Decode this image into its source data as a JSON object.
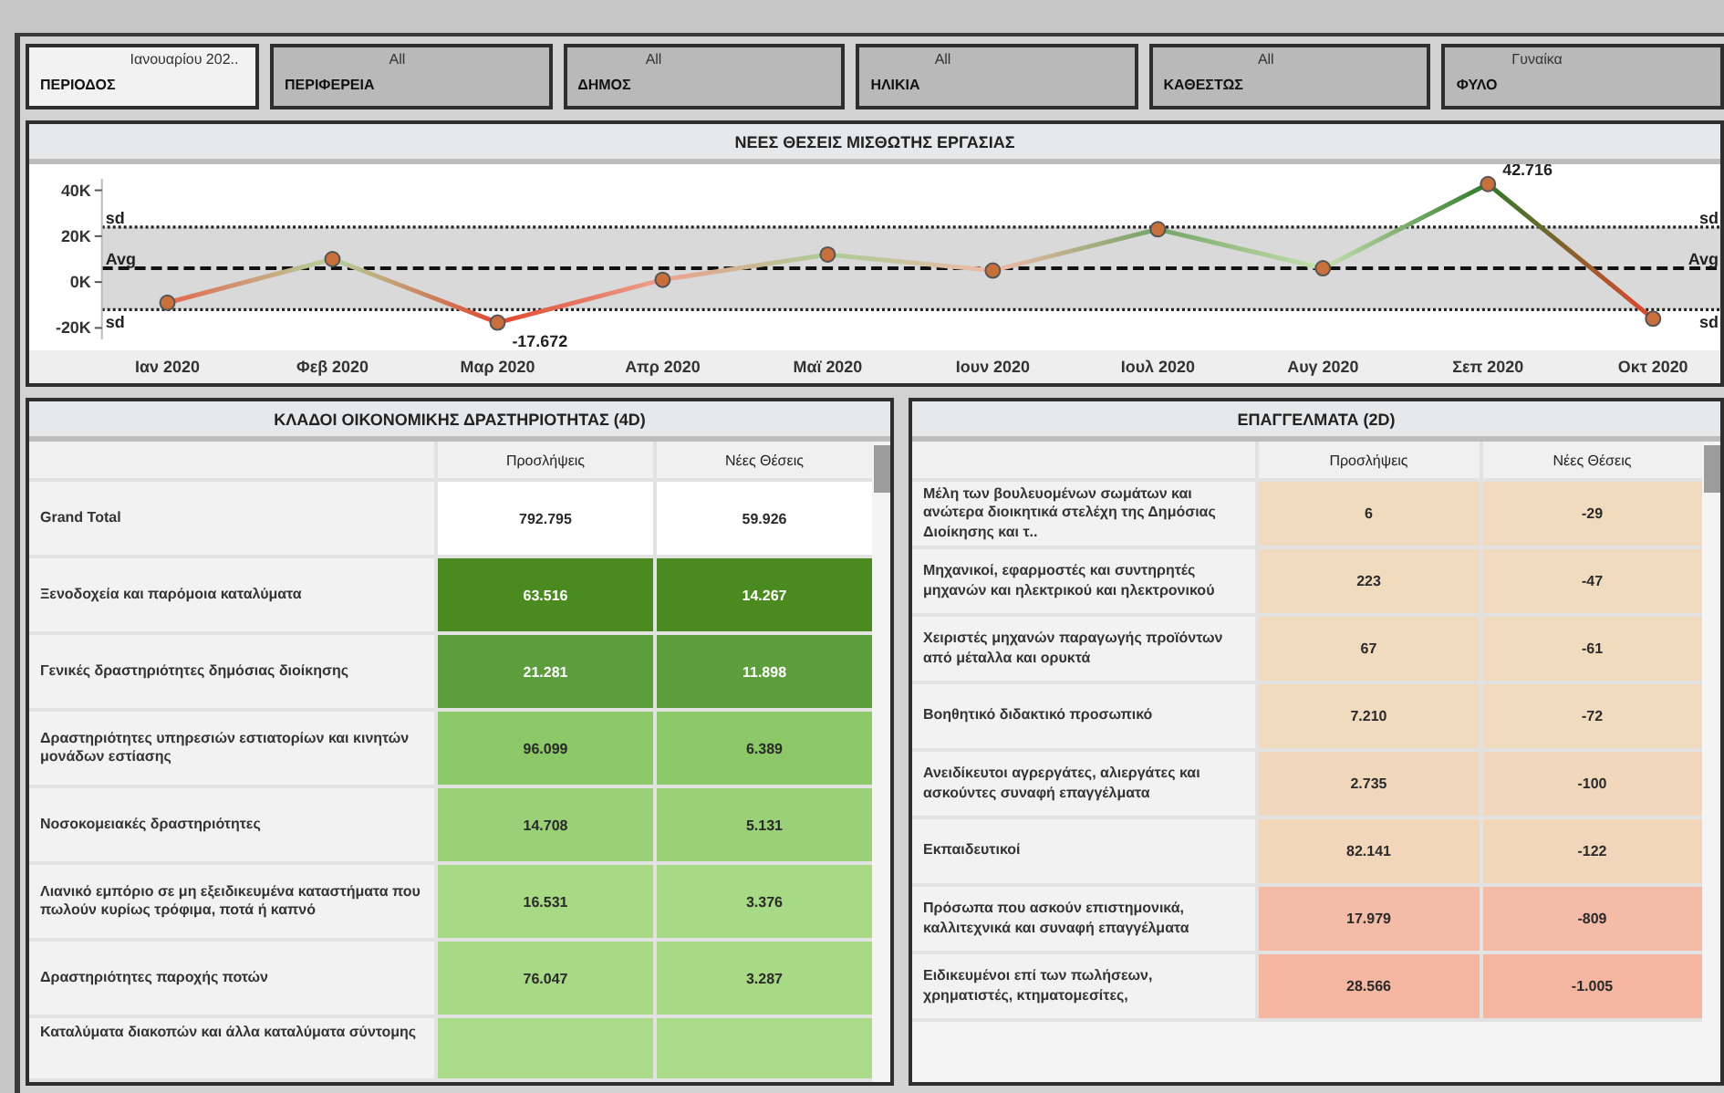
{
  "filters": [
    {
      "label": "ΠΕΡΙΟΔΟΣ",
      "value": "Ιανουαρίου 202..",
      "selected": true
    },
    {
      "label": "ΠΕΡΙΦΕΡΕΙΑ",
      "value": "All",
      "selected": false
    },
    {
      "label": "ΔΗΜΟΣ",
      "value": "All",
      "selected": false
    },
    {
      "label": "ΗΛΙΚΙΑ",
      "value": "All",
      "selected": false
    },
    {
      "label": "ΚΑΘΕΣΤΩΣ",
      "value": "All",
      "selected": false
    },
    {
      "label": "ΦΥΛΟ",
      "value": "Γυναίκα",
      "selected": false
    }
  ],
  "chart": {
    "title": "ΝΕΕΣ ΘΕΣΕΙΣ ΜΙΣΘΩΤΗΣ ΕΡΓΑΣΙΑΣ",
    "chart_data": {
      "type": "line",
      "categories": [
        "Ιαν 2020",
        "Φεβ 2020",
        "Μαρ 2020",
        "Απρ 2020",
        "Μαϊ 2020",
        "Ιουν 2020",
        "Ιουλ 2020",
        "Αυγ 2020",
        "Σεπ 2020",
        "Οκτ 2020"
      ],
      "series": [
        {
          "color": "#c8703c",
          "marker": "circle",
          "values": [
            -9000,
            10000,
            -17672,
            1000,
            12000,
            5000,
            23000,
            6000,
            42716,
            -16000
          ]
        }
      ],
      "value_labels": [
        null,
        null,
        "-17.672",
        null,
        null,
        null,
        null,
        null,
        "42.716",
        null
      ],
      "ylim": [
        -25000,
        45000
      ],
      "yticks": [
        {
          "value": 40000,
          "label": "40K"
        },
        {
          "value": 20000,
          "label": "20K"
        },
        {
          "value": 0,
          "label": "0K"
        },
        {
          "value": -20000,
          "label": "-20K"
        }
      ],
      "bands": [
        {
          "axis": "y",
          "from": -12000,
          "to": 24000
        }
      ],
      "ref_lines": [
        {
          "axis": "y",
          "value": 24000,
          "label": "sd"
        },
        {
          "axis": "y",
          "value": 6000,
          "label": "Avg"
        },
        {
          "axis": "y",
          "value": -12000,
          "label": "sd"
        }
      ],
      "annotations": [
        "sd",
        "Avg",
        "sd"
      ]
    }
  },
  "tables": [
    {
      "title": "ΚΛΑΔΟΙ ΟΙΚΟΝΟΜΙΚΗΣ ΔΡΑΣΤΗΡΙΟΤΗΤΑΣ (4D)",
      "columns": [
        "Προσλήψεις",
        "Νέες Θέσεις"
      ],
      "rows": [
        {
          "label": "Grand Total",
          "hires": "792.795",
          "new_positions": "59.926",
          "color": "#ffffff"
        },
        {
          "label": "Ξενοδοχεία και παρόμοια καταλύματα",
          "hires": "63.516",
          "new_positions": "14.267",
          "color": "#4a8a1e"
        },
        {
          "label": "Γενικές δραστηριότητες δημόσιας διοίκησης",
          "hires": "21.281",
          "new_positions": "11.898",
          "color": "#5c9e3c"
        },
        {
          "label": "Δραστηριότητες υπηρεσιών εστιατορίων και κινητών μονάδων εστίασης",
          "hires": "96.099",
          "new_positions": "6.389",
          "color": "#8cc868"
        },
        {
          "label": "Νοσοκομειακές δραστηριότητες",
          "hires": "14.708",
          "new_positions": "5.131",
          "color": "#9ad078"
        },
        {
          "label": "Λιανικό εμπόριο σε μη εξειδικευμένα καταστήματα που πωλούν κυρίως τρόφιμα, ποτά ή καπνό",
          "hires": "16.531",
          "new_positions": "3.376",
          "color": "#a8da86"
        },
        {
          "label": "Δραστηριότητες παροχής ποτών",
          "hires": "76.047",
          "new_positions": "3.287",
          "color": "#a8da86"
        },
        {
          "label": "Καταλύματα διακοπών και άλλα καταλύματα σύντομης",
          "color": "#aadb88"
        }
      ]
    },
    {
      "title": "ΕΠΑΓΓΕΛΜΑΤΑ (2D)",
      "columns": [
        "Προσλήψεις",
        "Νέες Θέσεις"
      ],
      "rows": [
        {
          "label": "Μέλη των βουλευομένων σωμάτων και ανώτερα διοικητικά στελέχη της Δημόσιας Διοίκησης και τ..",
          "hires": "6",
          "new_positions": "-29",
          "color": "#f1dbbe"
        },
        {
          "label": "Μηχανικοί, εφαρμοστές και συντηρητές μηχανών και ηλεκτρικού και ηλεκτρονικού",
          "hires": "223",
          "new_positions": "-47",
          "color": "#f1dbbe"
        },
        {
          "label": "Χειριστές μηχανών παραγωγής προϊόντων από μέταλλα και ορυκτά",
          "hires": "67",
          "new_positions": "-61",
          "color": "#f1dbbe"
        },
        {
          "label": "Βοηθητικό διδακτικό προσωπικό",
          "hires": "7.210",
          "new_positions": "-72",
          "color": "#f1dbbe"
        },
        {
          "label": "Ανειδίκευτοι αγρεργάτες, αλιεργάτες και ασκούντες συναφή επαγγέλματα",
          "hires": "2.735",
          "new_positions": "-100",
          "color": "#f1d8bc"
        },
        {
          "label": "Εκπαιδευτικοί",
          "hires": "82.141",
          "new_positions": "-122",
          "color": "#f1d6ba"
        },
        {
          "label": "Πρόσωπα που ασκούν επιστημονικά, καλλιτεχνικά και συναφή επαγγέλματα",
          "hires": "17.979",
          "new_positions": "-809",
          "color": "#f4bba6"
        },
        {
          "label": "Ειδικευμένοι επί των πωλήσεων, χρηματιστές, κτηματομεσίτες,",
          "hires": "28.566",
          "new_positions": "-1.005",
          "color": "#f4b6a0"
        }
      ]
    }
  ]
}
